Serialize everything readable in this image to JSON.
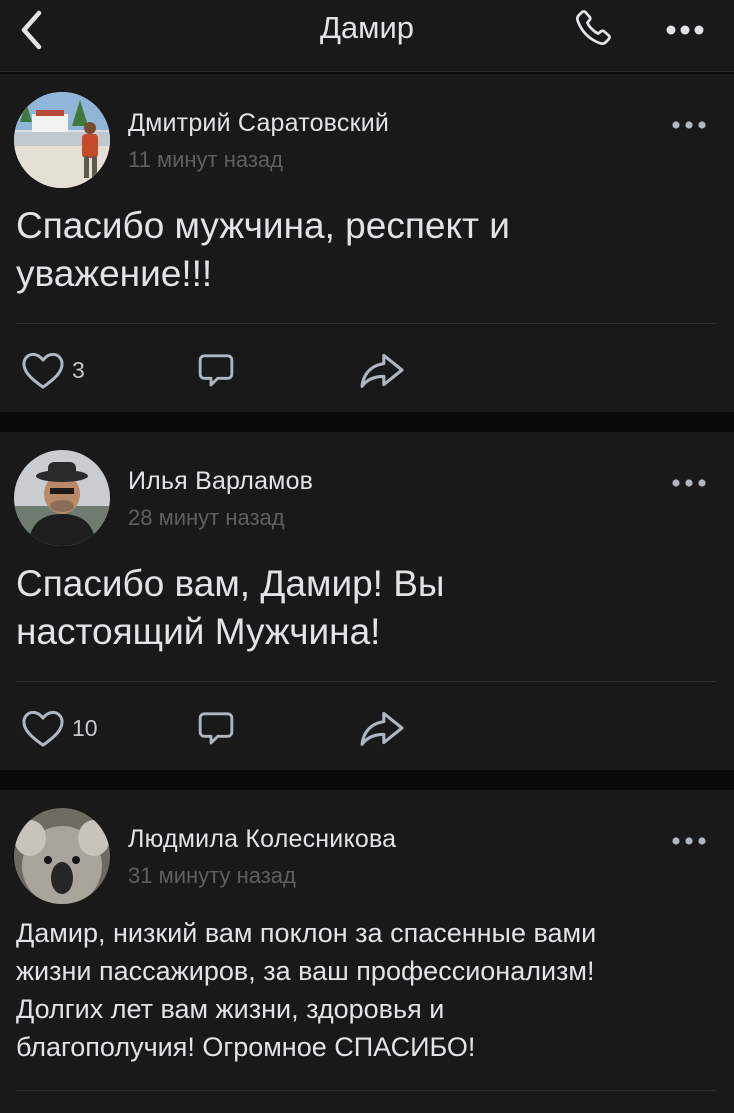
{
  "header": {
    "title": "Дамир",
    "back_icon": "chevron-left-icon",
    "call_icon": "phone-icon",
    "more_icon": "more-horizontal-icon"
  },
  "posts": [
    {
      "author": "Дмитрий Саратовский",
      "time": "11 минут назад",
      "text_line1": "Спасибо мужчина, респект и",
      "text_line2": "уважение!!!",
      "likes": "3"
    },
    {
      "author": "Илья Варламов",
      "time": "28 минут назад",
      "text_line1": "Спасибо вам, Дамир! Вы",
      "text_line2": "настоящий Мужчина!",
      "likes": "10"
    },
    {
      "author": "Людмила Колесникова",
      "time": "31 минуту назад",
      "text_line1": "Дамир, низкий вам поклон за спасенные вами",
      "text_line2": "жизни пассажиров, за ваш профессионализм!",
      "text_line3": "Долгих лет вам жизни, здоровья и",
      "text_line4": "благополучия! Огромное СПАСИБО!"
    }
  ],
  "colors": {
    "background": "#0a0a0a",
    "card": "#19191a",
    "text_primary": "#e1e3e6",
    "text_secondary": "#5d5f61",
    "divider": "#2c2d2e"
  }
}
